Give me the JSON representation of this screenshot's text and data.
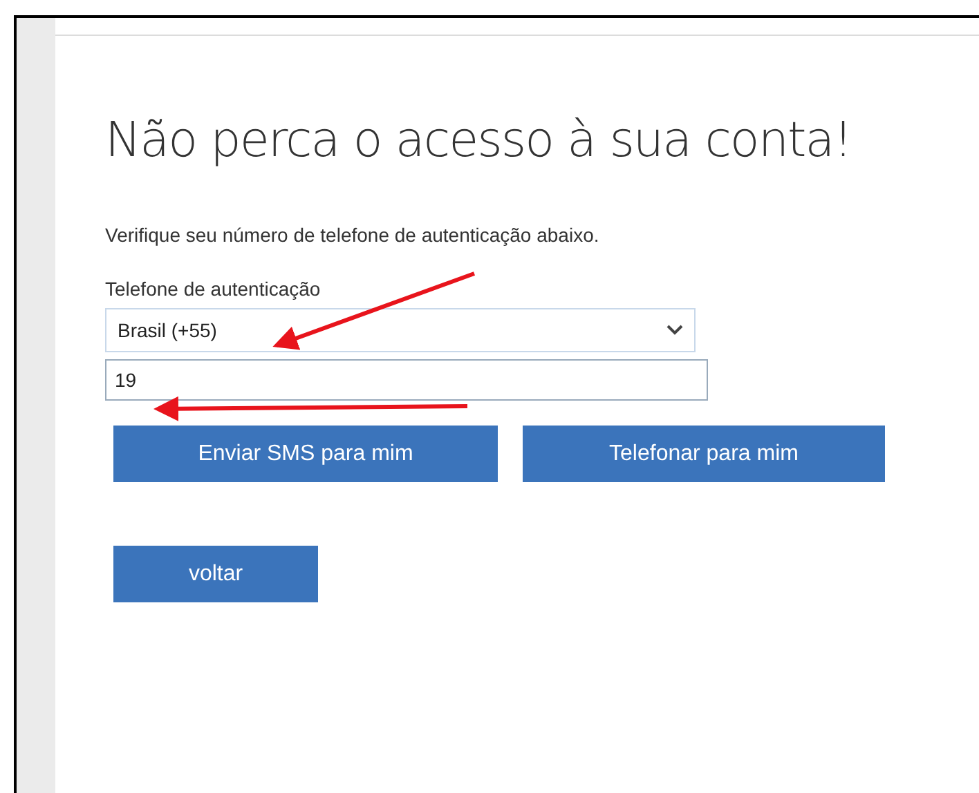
{
  "title": "Não perca o acesso à sua conta!",
  "instruction": "Verifique seu número de telefone de autenticação abaixo.",
  "phone_field": {
    "label": "Telefone de autenticação",
    "country": "Brasil (+55)",
    "number": "19"
  },
  "buttons": [
    {
      "label": "Enviar SMS para mim"
    },
    {
      "label": "Telefonar para mim"
    }
  ],
  "back_button": {
    "label": "voltar"
  }
}
